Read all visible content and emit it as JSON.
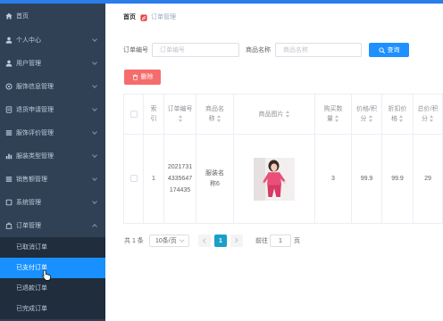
{
  "colors": {
    "top_bar": "#2b7de9",
    "sidebar_bg": "#304156",
    "submenu_bg": "#1f2d3d",
    "active_menu": "#1890ff",
    "primary_button": "#1e90ff",
    "danger_button": "#f56c6c",
    "active_page": "#1a9fc9",
    "breadcrumb_icon": "#e8453c"
  },
  "sidebar": {
    "items": [
      {
        "label": "首页",
        "icon": "home-icon"
      },
      {
        "label": "个人中心",
        "icon": "user-icon"
      },
      {
        "label": "用户管理",
        "icon": "user-icon"
      },
      {
        "label": "服饰信息管理",
        "icon": "info-circle-icon"
      },
      {
        "label": "退货申请管理",
        "icon": "document-icon"
      },
      {
        "label": "服饰评价管理",
        "icon": "list-icon"
      },
      {
        "label": "服装类型管理",
        "icon": "chart-icon"
      },
      {
        "label": "销售额管理",
        "icon": "list-icon"
      },
      {
        "label": "系统管理",
        "icon": "square-icon"
      },
      {
        "label": "订单管理",
        "icon": "order-icon",
        "expanded": true
      }
    ],
    "submenu": [
      {
        "label": "已取消订单"
      },
      {
        "label": "已支付订单",
        "active": true
      },
      {
        "label": "已退款订单"
      },
      {
        "label": "已完成订单"
      }
    ]
  },
  "breadcrumb": {
    "home": "首页",
    "current": "订单管理",
    "separator_icon": "breadcrumb-separator-icon"
  },
  "search": {
    "order_no_label": "订单编号",
    "order_no_placeholder": "订单编号",
    "product_label": "商品名称",
    "product_placeholder": "商品名称",
    "query_label": "查询",
    "query_icon": "search-icon"
  },
  "toolbar": {
    "delete_label": "删除",
    "delete_icon": "trash-icon"
  },
  "table": {
    "headers": {
      "index": "索引",
      "order_no": "订单编号",
      "product_name": "商品名称",
      "image": "商品图片",
      "quantity": "购买数量",
      "price": "价格/积分",
      "discount_price": "折扣价格",
      "total": "总价/积分"
    },
    "rows": [
      {
        "index": "1",
        "order_no": "20217314335647174435",
        "product_name": "服装名称6",
        "image": "product-photo",
        "quantity": "3",
        "price": "99.9",
        "discount_price": "99.9",
        "total": "29"
      }
    ]
  },
  "pagination": {
    "total": "共 1 条",
    "page_size": "10条/页",
    "current_page": "1",
    "goto_label": "前往",
    "goto_value": "1",
    "goto_suffix": "页"
  }
}
